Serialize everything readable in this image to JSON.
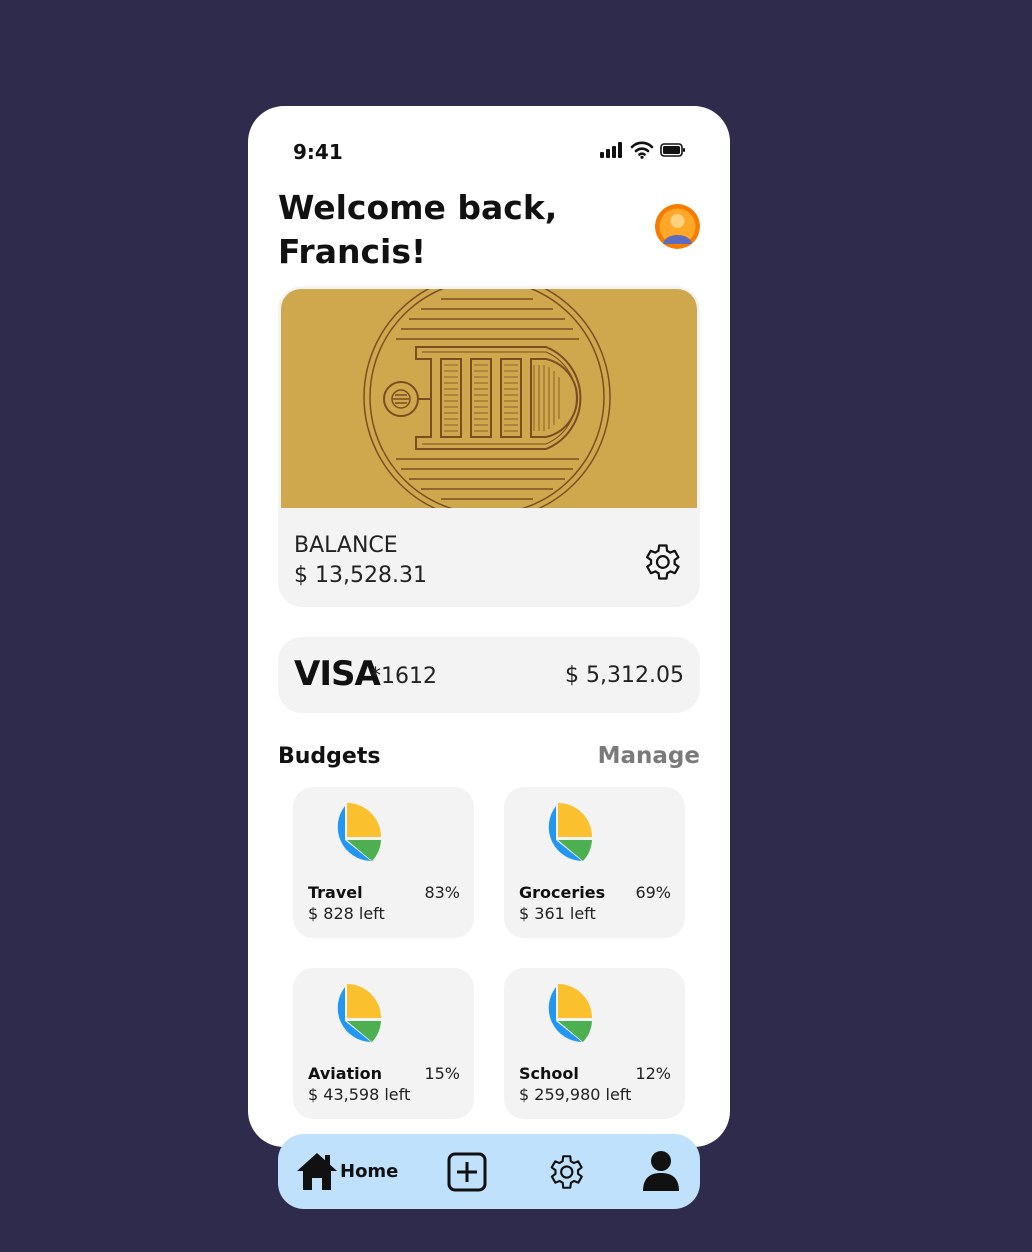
{
  "status_bar": {
    "time": "9:41"
  },
  "header": {
    "greeting": "Welcome back,\nFrancis!"
  },
  "balance_card": {
    "label": "BALANCE",
    "value": "$ 13,528.31"
  },
  "visa_card": {
    "brand": "VISA",
    "last4": "*1612",
    "amount": "$ 5,312.05"
  },
  "budgets": {
    "title": "Budgets",
    "manage_label": "Manage",
    "items": [
      {
        "name": "Travel",
        "percent": "83%",
        "left": "$ 828 left"
      },
      {
        "name": "Groceries",
        "percent": "69%",
        "left": "$ 361 left"
      },
      {
        "name": "Aviation",
        "percent": "15%",
        "left": "$ 43,598 left"
      },
      {
        "name": "School",
        "percent": "12%",
        "left": "$ 259,980 left"
      }
    ]
  },
  "bottom_nav": {
    "home_label": "Home",
    "items": [
      "home-icon",
      "add-icon",
      "settings-icon",
      "profile-icon"
    ]
  },
  "colors": {
    "background": "#2f2b4c",
    "card_gold": "#cfa84e",
    "nav_bg": "#bfe1fb",
    "pie_blue": "#2196f3",
    "pie_yellow": "#fbc02d",
    "pie_green": "#4caf50"
  }
}
